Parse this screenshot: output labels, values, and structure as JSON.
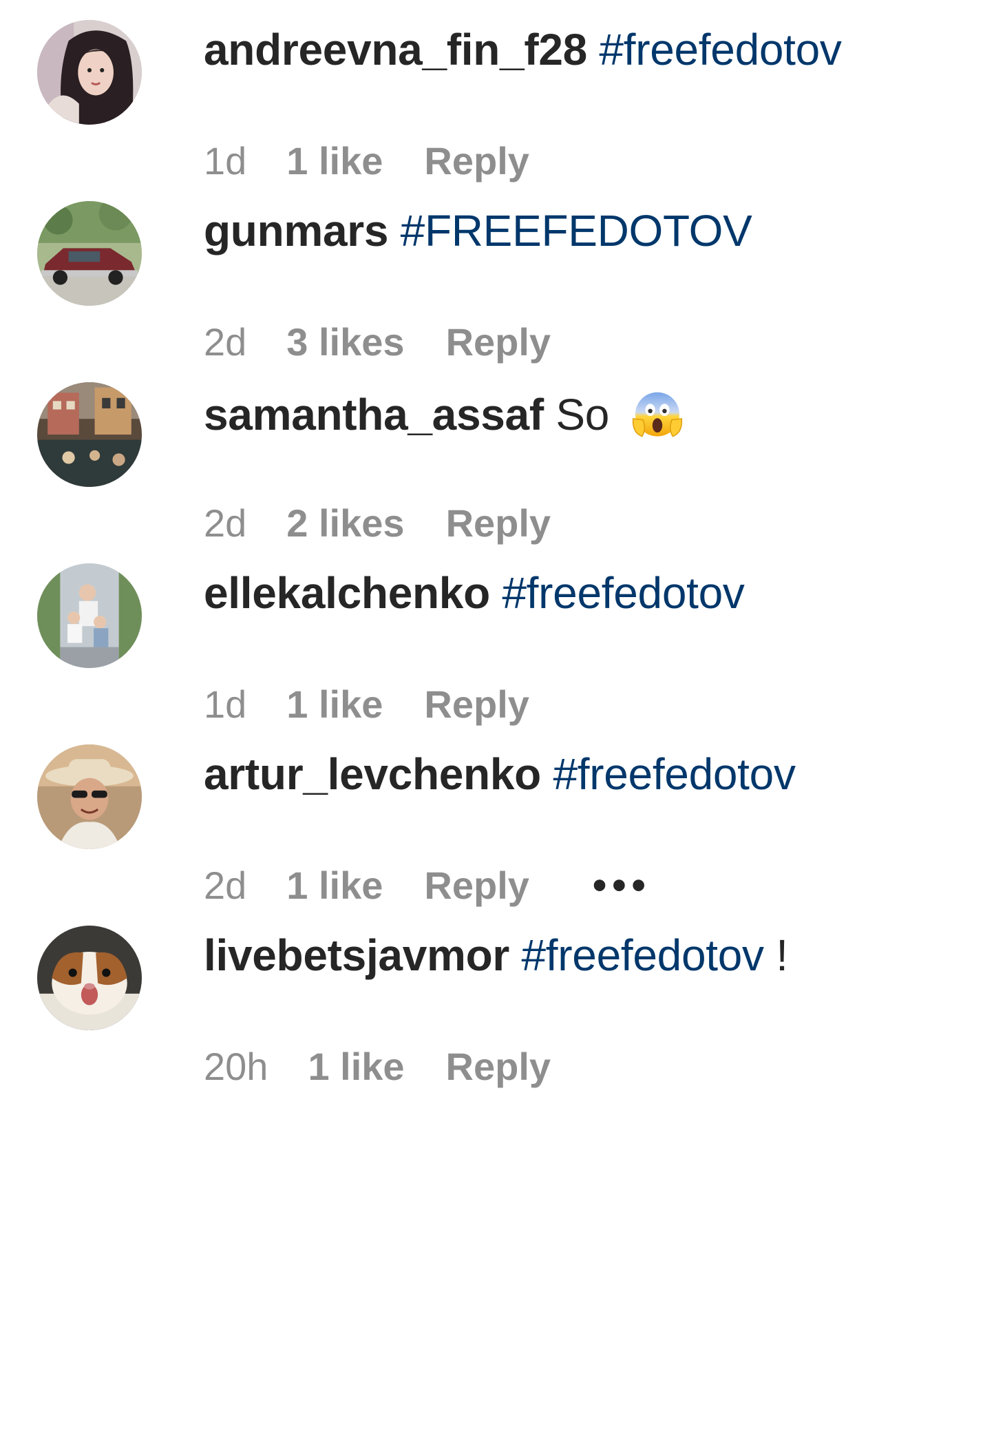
{
  "comments": [
    {
      "username": "andreevna_fin_f28",
      "text_before": "",
      "hashtag": "#freefedotov",
      "text_after": "",
      "time": "1d",
      "likes": "1 like",
      "reply": "Reply",
      "avatar_icon": "avatar-woman-dark-hair"
    },
    {
      "username": "gunmars",
      "text_before": "",
      "hashtag": "#FREEFEDOTOV",
      "text_after": "",
      "time": "2d",
      "likes": "3 likes",
      "reply": "Reply",
      "avatar_icon": "avatar-red-car"
    },
    {
      "username": "samantha_assaf",
      "text_before": "So",
      "hashtag": "",
      "text_after": "",
      "emoji": "face-screaming-in-fear",
      "time": "2d",
      "likes": "2 likes",
      "reply": "Reply",
      "avatar_icon": "avatar-street-scene"
    },
    {
      "username": "ellekalchenko",
      "text_before": "",
      "hashtag": "#freefedotov",
      "text_after": "",
      "time": "1d",
      "likes": "1 like",
      "reply": "Reply",
      "avatar_icon": "avatar-family-photo"
    },
    {
      "username": "artur_levchenko",
      "text_before": "",
      "hashtag": "#freefedotov",
      "text_after": "",
      "time": "2d",
      "likes": "1 like",
      "reply": "Reply",
      "more": "•••",
      "avatar_icon": "avatar-man-hat-sunglasses"
    },
    {
      "username": "livebetsjavmor",
      "text_before": "",
      "hashtag": "#freefedotov",
      "text_after": "!",
      "time": "20h",
      "likes": "1 like",
      "reply": "Reply",
      "avatar_icon": "avatar-guinea-pig"
    }
  ],
  "colors": {
    "username": "#262626",
    "hashtag": "#00376b",
    "meta": "#8e8e8e"
  }
}
